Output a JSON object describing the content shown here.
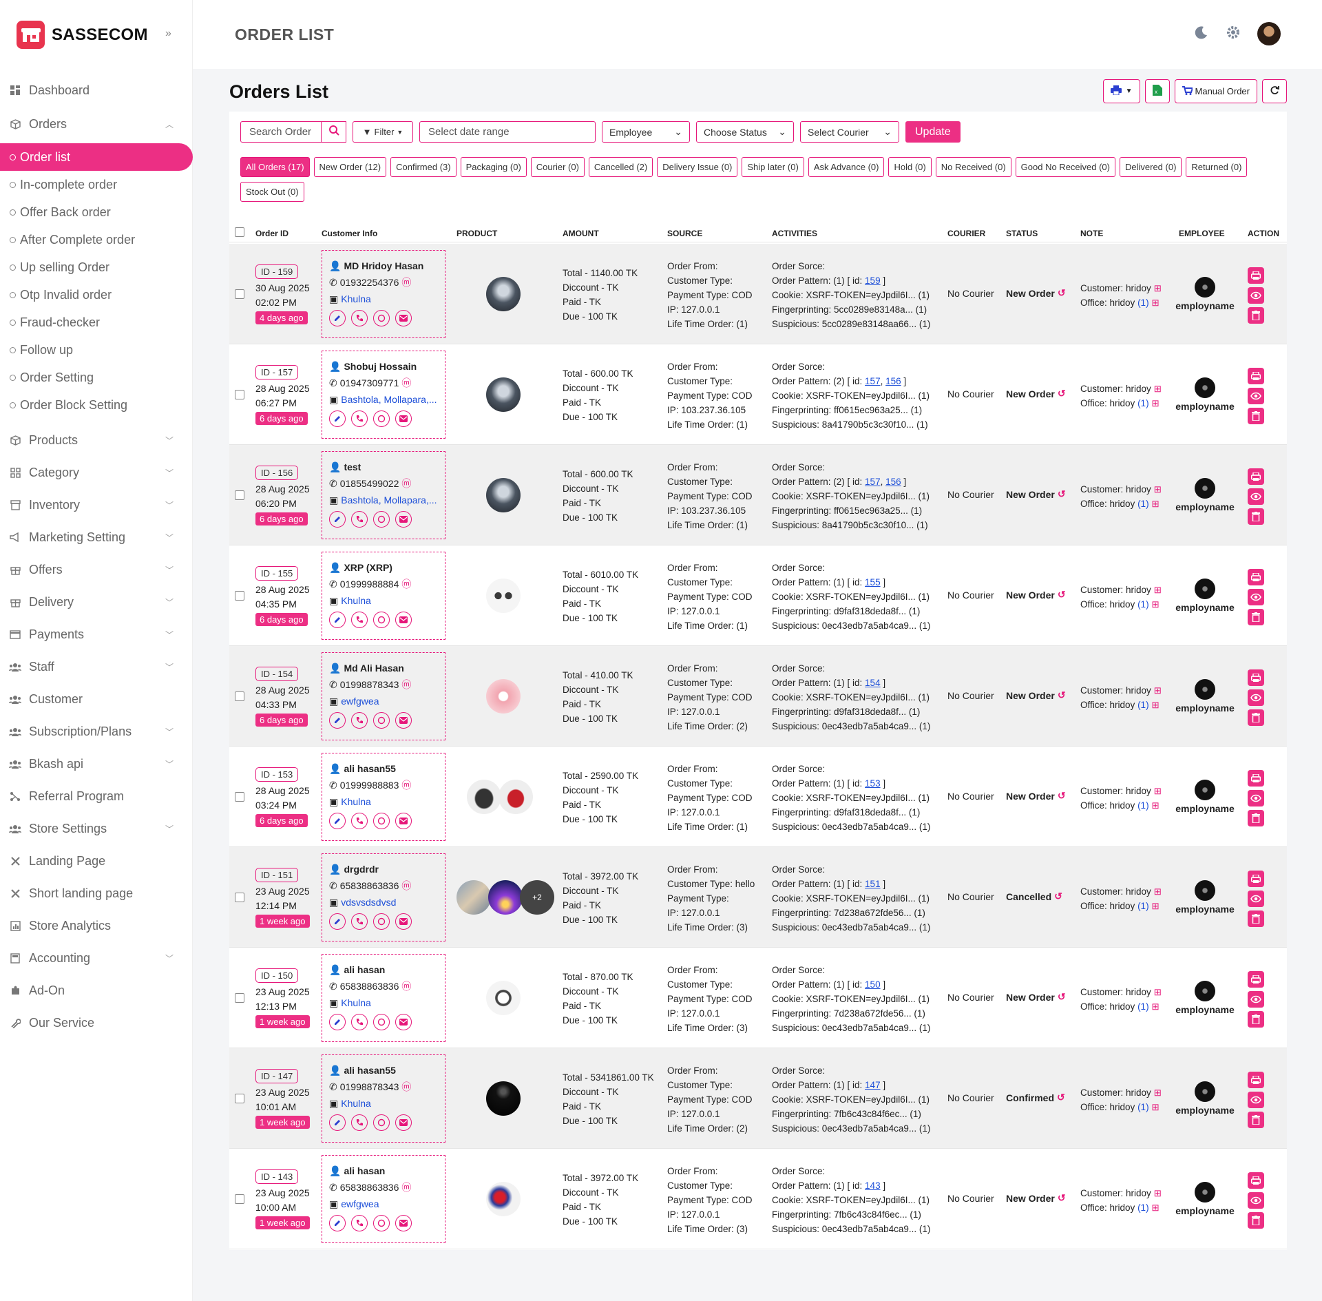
{
  "brand": {
    "name": "SASSECOM",
    "accent": "#ec2f84",
    "logo_color": "#e8344e"
  },
  "page_title": "ORDER LIST",
  "card_title": "Orders List",
  "header_buttons": {
    "print": "print-icon",
    "export": "excel-icon",
    "manual_order": "Manual Order",
    "refresh": "refresh-icon"
  },
  "sidebar": {
    "top": [
      {
        "label": "Dashboard",
        "icon": "dashboard-icon"
      },
      {
        "label": "Orders",
        "icon": "box-icon",
        "expanded": true
      }
    ],
    "order_sub": [
      {
        "label": "Order list",
        "active": true
      },
      {
        "label": "In-complete order"
      },
      {
        "label": "Offer Back order"
      },
      {
        "label": "After Complete order"
      },
      {
        "label": "Up selling Order"
      },
      {
        "label": "Otp Invalid order"
      },
      {
        "label": "Fraud-checker"
      },
      {
        "label": "Follow up"
      },
      {
        "label": "Order Setting"
      },
      {
        "label": "Order Block Setting"
      }
    ],
    "rest": [
      {
        "label": "Products",
        "icon": "box-icon",
        "chevron": true
      },
      {
        "label": "Category",
        "icon": "grid-icon",
        "chevron": true
      },
      {
        "label": "Inventory",
        "icon": "archive-icon",
        "chevron": true
      },
      {
        "label": "Marketing Setting",
        "icon": "megaphone-icon",
        "chevron": true
      },
      {
        "label": "Offers",
        "icon": "gift-icon",
        "chevron": true
      },
      {
        "label": "Delivery",
        "icon": "gift-icon",
        "chevron": true
      },
      {
        "label": "Payments",
        "icon": "card-icon",
        "chevron": true
      },
      {
        "label": "Staff",
        "icon": "people-icon",
        "chevron": true
      },
      {
        "label": "Customer",
        "icon": "people-icon",
        "chevron": false
      },
      {
        "label": "Subscription/Plans",
        "icon": "people-icon",
        "chevron": true
      },
      {
        "label": "Bkash api",
        "icon": "people-icon",
        "chevron": true
      },
      {
        "label": "Referral Program",
        "icon": "network-icon",
        "chevron": false
      },
      {
        "label": "Store Settings",
        "icon": "people-icon",
        "chevron": true
      },
      {
        "label": "Landing Page",
        "icon": "tools-icon",
        "chevron": false
      },
      {
        "label": "Short landing page",
        "icon": "tools-icon",
        "chevron": false
      },
      {
        "label": "Store Analytics",
        "icon": "chart-icon",
        "chevron": false
      },
      {
        "label": "Accounting",
        "icon": "calculator-icon",
        "chevron": true
      },
      {
        "label": "Ad-On",
        "icon": "puzzle-icon",
        "chevron": false
      },
      {
        "label": "Our Service",
        "icon": "wrench-icon",
        "chevron": false
      }
    ]
  },
  "filters": {
    "search_placeholder": "Search Order",
    "filter": "Filter",
    "date_placeholder": "Select date range",
    "employee": "Employee",
    "status": "Choose Status",
    "courier": "Select Courier",
    "update": "Update"
  },
  "tabs": [
    "All Orders (17)",
    "New Order (12)",
    "Confirmed (3)",
    "Packaging (0)",
    "Courier (0)",
    "Cancelled (2)",
    "Delivery Issue (0)",
    "Ship later (0)",
    "Ask Advance (0)",
    "Hold (0)",
    "No Received (0)",
    "Good No Received (0)",
    "Delivered (0)",
    "Returned (0)",
    "Stock Out (0)"
  ],
  "columns": {
    "order_id": "Order ID",
    "customer": "Customer Info",
    "product": "PRODUCT",
    "amount": "AMOUNT",
    "source": "SOURCE",
    "activities": "ACTIVITIES",
    "courier": "COURIER",
    "status": "STATUS",
    "note": "NOTE",
    "employee": "EMPLOYEE",
    "action": "ACTION"
  },
  "orders": [
    {
      "id": "ID - 159",
      "date": "30 Aug 2025",
      "time": "02:02 PM",
      "ago": "4 days ago",
      "name": "MD Hridoy Hasan",
      "phone": "01932254376",
      "loc": "Khulna",
      "total": "Total - 1140.00 TK",
      "ctype": "Customer Type:",
      "pay": "Payment Type: COD",
      "ip": "IP: 127.0.0.1",
      "life": "Life Time Order: (1)",
      "pattern_pre": "Order Pattern: (1) [ id: ",
      "links": [
        "159"
      ],
      "cookie": "Cookie: XSRF-TOKEN=eyJpdil6I... (1)",
      "fp": "Fingerprinting: 5cc0289e83148a... (1)",
      "susp": "Suspicious: 5cc0289e83148aa66... (1)",
      "status": "New Order",
      "imgs": [
        "mall"
      ]
    },
    {
      "id": "ID - 157",
      "date": "28 Aug 2025",
      "time": "06:27 PM",
      "ago": "6 days ago",
      "name": "Shobuj Hossain",
      "phone": "01947309771",
      "loc": "Bashtola, Mollapara,...",
      "total": "Total - 600.00 TK",
      "ctype": "Customer Type:",
      "pay": "Payment Type: COD",
      "ip": "IP: 103.237.36.105",
      "life": "Life Time Order: (1)",
      "pattern_pre": "Order Pattern: (2) [ id: ",
      "links": [
        "157",
        "156"
      ],
      "cookie": "Cookie: XSRF-TOKEN=eyJpdil6I... (1)",
      "fp": "Fingerprinting: ff0615ec963a25... (1)",
      "susp": "Suspicious: 8a41790b5c3c30f10... (1)",
      "status": "New Order",
      "imgs": [
        "mall"
      ]
    },
    {
      "id": "ID - 156",
      "date": "28 Aug 2025",
      "time": "06:20 PM",
      "ago": "6 days ago",
      "name": "test",
      "phone": "01855499022",
      "loc": "Bashtola, Mollapara,...",
      "total": "Total - 600.00 TK",
      "ctype": "Customer Type:",
      "pay": "Payment Type: COD",
      "ip": "IP: 103.237.36.105",
      "life": "Life Time Order: (1)",
      "pattern_pre": "Order Pattern: (2) [ id: ",
      "links": [
        "157",
        "156"
      ],
      "cookie": "Cookie: XSRF-TOKEN=eyJpdil6I... (1)",
      "fp": "Fingerprinting: ff0615ec963a25... (1)",
      "susp": "Suspicious: 8a41790b5c3c30f10... (1)",
      "status": "New Order",
      "imgs": [
        "mall"
      ]
    },
    {
      "id": "ID - 155",
      "date": "28 Aug 2025",
      "time": "04:35 PM",
      "ago": "6 days ago",
      "name": "XRP (XRP)",
      "phone": "01999988884",
      "loc": "Khulna",
      "total": "Total - 6010.00 TK",
      "ctype": "Customer Type:",
      "pay": "Payment Type: COD",
      "ip": "IP: 127.0.0.1",
      "life": "Life Time Order: (1)",
      "pattern_pre": "Order Pattern: (1) [ id: ",
      "links": [
        "155"
      ],
      "cookie": "Cookie: XSRF-TOKEN=eyJpdil6I... (1)",
      "fp": "Fingerprinting: d9faf318deda8f... (1)",
      "susp": "Suspicious: 0ec43edb7a5ab4ca9... (1)",
      "status": "New Order",
      "imgs": [
        "glasses"
      ]
    },
    {
      "id": "ID - 154",
      "date": "28 Aug 2025",
      "time": "04:33 PM",
      "ago": "6 days ago",
      "name": "Md Ali Hasan",
      "phone": "01998878343",
      "loc": "ewfgwea",
      "total": "Total - 410.00 TK",
      "ctype": "Customer Type:",
      "pay": "Payment Type: COD",
      "ip": "IP: 127.0.0.1",
      "life": "Life Time Order: (2)",
      "pattern_pre": "Order Pattern: (1) [ id: ",
      "links": [
        "154"
      ],
      "cookie": "Cookie: XSRF-TOKEN=eyJpdil6I... (1)",
      "fp": "Fingerprinting: d9faf318deda8f... (1)",
      "susp": "Suspicious: 0ec43edb7a5ab4ca9... (1)",
      "status": "New Order",
      "imgs": [
        "pink"
      ]
    },
    {
      "id": "ID - 153",
      "date": "28 Aug 2025",
      "time": "03:24 PM",
      "ago": "6 days ago",
      "name": "ali hasan55",
      "phone": "01999988883",
      "loc": "Khulna",
      "total": "Total - 2590.00 TK",
      "ctype": "Customer Type:",
      "pay": "Payment Type: COD",
      "ip": "IP: 127.0.0.1",
      "life": "Life Time Order: (1)",
      "pattern_pre": "Order Pattern: (1) [ id: ",
      "links": [
        "153"
      ],
      "cookie": "Cookie: XSRF-TOKEN=eyJpdil6I... (1)",
      "fp": "Fingerprinting: d9faf318deda8f... (1)",
      "susp": "Suspicious: 0ec43edb7a5ab4ca9... (1)",
      "status": "New Order",
      "imgs": [
        "shoe",
        "bag"
      ]
    },
    {
      "id": "ID - 151",
      "date": "23 Aug 2025",
      "time": "12:14 PM",
      "ago": "1 week ago",
      "name": "drgdrdr",
      "phone": "65838863836",
      "loc": "vdsvsdsdvsd",
      "total": "Total - 3972.00 TK",
      "ctype": "Customer Type: hello",
      "pay": "Payment Type:",
      "ip": "IP: 127.0.0.1",
      "life": "Life Time Order: (3)",
      "pattern_pre": "Order Pattern: (1) [ id: ",
      "links": [
        "151"
      ],
      "cookie": "Cookie: XSRF-TOKEN=eyJpdil6I... (1)",
      "fp": "Fingerprinting: 7d238a672fde56... (1)",
      "susp": "Suspicious: 0ec43edb7a5ab4ca9... (1)",
      "status": "Cancelled",
      "imgs": [
        "people",
        "city"
      ],
      "more": "+2"
    },
    {
      "id": "ID - 150",
      "date": "23 Aug 2025",
      "time": "12:13 PM",
      "ago": "1 week ago",
      "name": "ali hasan",
      "phone": "65838863836",
      "loc": "Khulna",
      "total": "Total - 870.00 TK",
      "ctype": "Customer Type:",
      "pay": "Payment Type: COD",
      "ip": "IP: 127.0.0.1",
      "life": "Life Time Order: (3)",
      "pattern_pre": "Order Pattern: (1) [ id: ",
      "links": [
        "150"
      ],
      "cookie": "Cookie: XSRF-TOKEN=eyJpdil6I... (1)",
      "fp": "Fingerprinting: 7d238a672fde56... (1)",
      "susp": "Suspicious: 0ec43edb7a5ab4ca9... (1)",
      "status": "New Order",
      "imgs": [
        "headphone"
      ]
    },
    {
      "id": "ID - 147",
      "date": "23 Aug 2025",
      "time": "10:01 AM",
      "ago": "1 week ago",
      "name": "ali hasan55",
      "phone": "01998878343",
      "loc": "Khulna",
      "total": "Total - 5341861.00 TK",
      "ctype": "Customer Type:",
      "pay": "Payment Type: COD",
      "ip": "IP: 127.0.0.1",
      "life": "Life Time Order: (2)",
      "pattern_pre": "Order Pattern: (1) [ id: ",
      "links": [
        "147"
      ],
      "cookie": "Cookie: XSRF-TOKEN=eyJpdil6I... (1)",
      "fp": "Fingerprinting: 7fb6c43c84f6ec... (1)",
      "susp": "Suspicious: 0ec43edb7a5ab4ca9... (1)",
      "status": "Confirmed",
      "imgs": [
        "dark"
      ]
    },
    {
      "id": "ID - 143",
      "date": "23 Aug 2025",
      "time": "10:00 AM",
      "ago": "1 week ago",
      "name": "ali hasan",
      "phone": "65838863836",
      "loc": "ewfgwea",
      "total": "Total - 3972.00 TK",
      "ctype": "Customer Type:",
      "pay": "Payment Type: COD",
      "ip": "IP: 127.0.0.1",
      "life": "Life Time Order: (3)",
      "pattern_pre": "Order Pattern: (1) [ id: ",
      "links": [
        "143"
      ],
      "cookie": "Cookie: XSRF-TOKEN=eyJpdil6I... (1)",
      "fp": "Fingerprinting: 7fb6c43c84f6ec... (1)",
      "susp": "Suspicious: 0ec43edb7a5ab4ca9... (1)",
      "status": "New Order",
      "imgs": [
        "fruit"
      ]
    }
  ],
  "row_common": {
    "discount": "Diccount - TK",
    "paid": "Paid - TK",
    "due": "Due - 100 TK",
    "order_from": "Order From:",
    "order_source": "Order Sorce:",
    "courier": "No Courier",
    "note_customer": "Customer: hridoy",
    "note_office": "Office: hridoy",
    "note_count": "(1)",
    "employee": "employname"
  }
}
